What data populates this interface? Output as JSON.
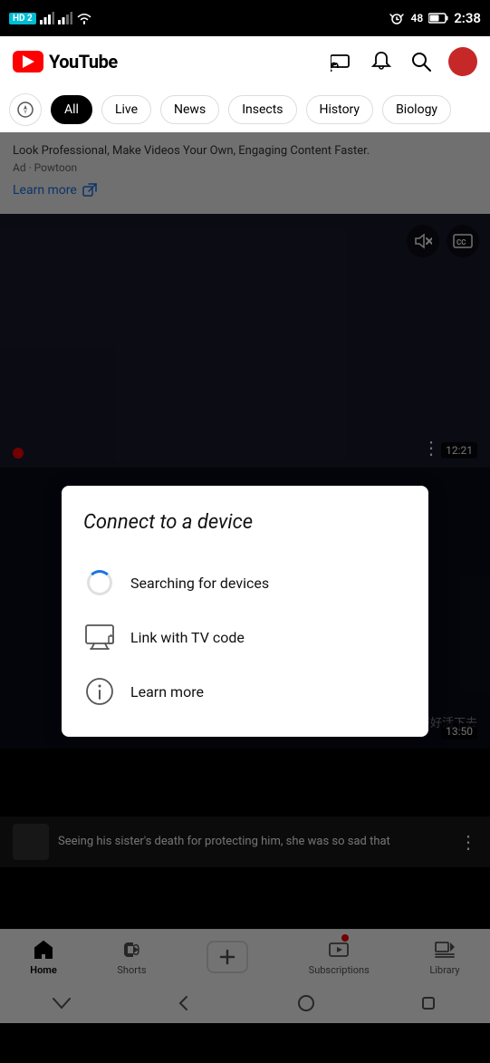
{
  "statusBar": {
    "badge": "HD 2",
    "time": "2:38",
    "batteryLevel": "48"
  },
  "header": {
    "title": "YouTube",
    "castLabel": "Cast",
    "notificationLabel": "Notifications",
    "searchLabel": "Search",
    "profileLabel": "Profile"
  },
  "filterBar": {
    "exploreLabel": "Explore",
    "chips": [
      {
        "label": "All",
        "active": true
      },
      {
        "label": "Live",
        "active": false
      },
      {
        "label": "News",
        "active": false
      },
      {
        "label": "Insects",
        "active": false
      },
      {
        "label": "History",
        "active": false
      },
      {
        "label": "Biology",
        "active": false
      }
    ]
  },
  "adSection": {
    "adText": "Look Professional, Make Videos Your Own, Engaging Content Faster.",
    "adSub": "Ad · Powtoon",
    "learnMore": "Learn more"
  },
  "video1": {
    "duration": "12:21"
  },
  "modal": {
    "title": "Connect to a device",
    "items": [
      {
        "id": "searching",
        "label": "Searching for devices",
        "iconType": "spinner"
      },
      {
        "id": "tv-code",
        "label": "Link with TV code",
        "iconType": "tv"
      },
      {
        "id": "learn-more",
        "label": "Learn more",
        "iconType": "info"
      }
    ]
  },
  "video2": {
    "textOverlay": "好好活下去",
    "duration": "13:50"
  },
  "miniPlayer": {
    "text": "Seeing his sister's death for protecting him, she was so sad that"
  },
  "bottomNav": {
    "items": [
      {
        "id": "home",
        "label": "Home",
        "active": true
      },
      {
        "id": "shorts",
        "label": "Shorts",
        "active": false
      },
      {
        "id": "create",
        "label": "",
        "active": false
      },
      {
        "id": "subscriptions",
        "label": "Subscriptions",
        "active": false,
        "badge": true
      },
      {
        "id": "library",
        "label": "Library",
        "active": false
      }
    ]
  }
}
